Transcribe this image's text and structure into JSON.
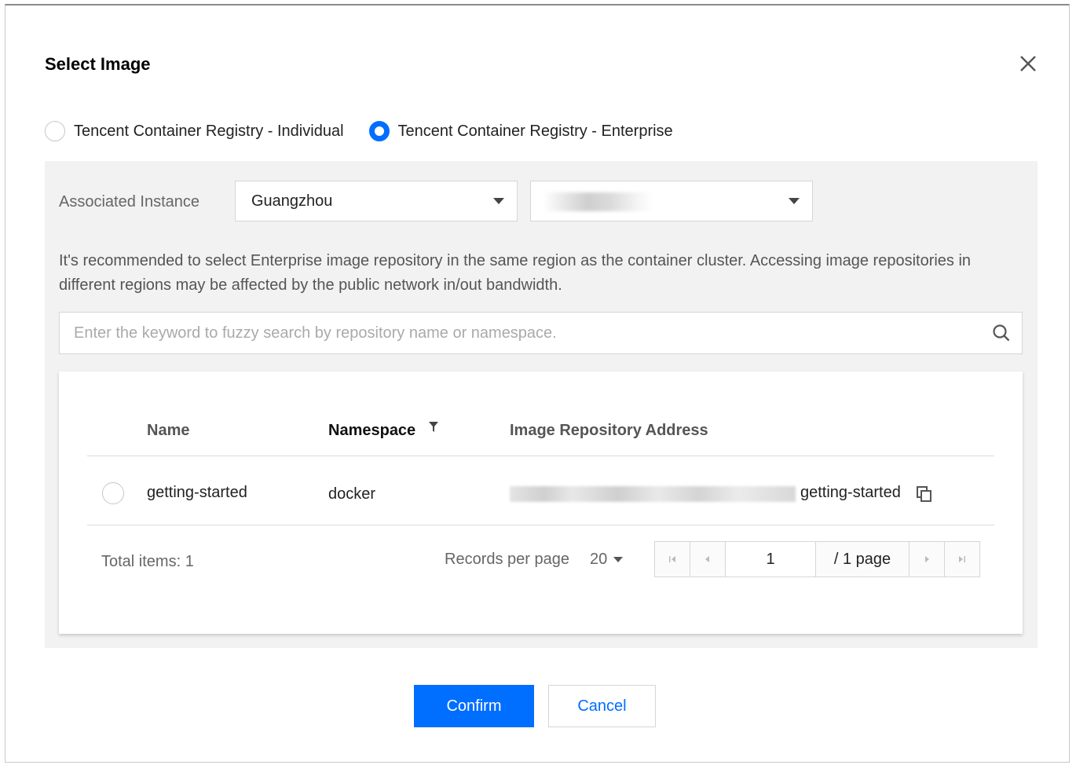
{
  "dialog": {
    "title": "Select Image"
  },
  "registry_options": [
    {
      "label": "Tencent Container Registry - Individual",
      "checked": false
    },
    {
      "label": "Tencent Container Registry - Enterprise",
      "checked": true
    }
  ],
  "instance": {
    "label": "Associated Instance",
    "region": "Guangzhou",
    "instance_value": ""
  },
  "notice": "It's recommended to select Enterprise image repository in the same region as the container cluster. Accessing image repositories in different regions may be affected by the public network in/out bandwidth.",
  "search": {
    "placeholder": "Enter the keyword to fuzzy search by repository name or namespace.",
    "value": ""
  },
  "table": {
    "columns": {
      "name": "Name",
      "namespace": "Namespace",
      "address": "Image Repository Address"
    },
    "rows": [
      {
        "name": "getting-started",
        "namespace": "docker",
        "address_suffix": "getting-started"
      }
    ]
  },
  "pagination": {
    "total_label": "Total items:",
    "total": "1",
    "records_label": "Records per page",
    "page_size": "20",
    "current_page": "1",
    "total_pages": "/ 1 page"
  },
  "buttons": {
    "confirm": "Confirm",
    "cancel": "Cancel"
  },
  "colors": {
    "accent": "#006eff"
  }
}
